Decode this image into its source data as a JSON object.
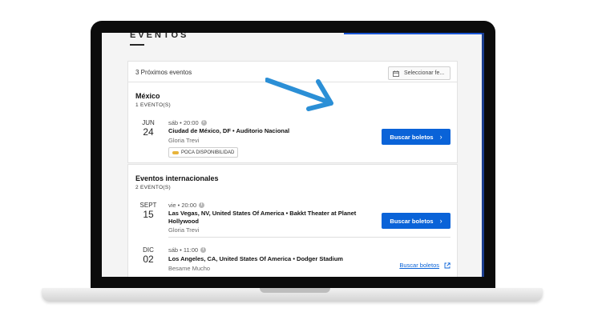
{
  "page": {
    "title": "EVENTOS"
  },
  "header": {
    "upcoming_count": "3 Próximos eventos",
    "date_picker_label": "Seleccionar fe..."
  },
  "sections": [
    {
      "title": "México",
      "count": "1 EVENTO(S)",
      "events": [
        {
          "month": "JUN",
          "day": "24",
          "time": "sáb • 20:00",
          "venue": "Ciudad de México, DF • Auditorio Nacional",
          "artist": "Gloria Trevi",
          "badge": "POCA DISPONIBILIDAD",
          "action": "Buscar boletos",
          "action_style": "button"
        }
      ]
    },
    {
      "title": "Eventos internacionales",
      "count": "2 EVENTO(S)",
      "events": [
        {
          "month": "SEPT",
          "day": "15",
          "time": "vie • 20:00",
          "venue": "Las Vegas, NV, United States Of America • Bakkt Theater at Planet Hollywood",
          "artist": "Gloria Trevi",
          "action": "Buscar boletos",
          "action_style": "button"
        },
        {
          "month": "DIC",
          "day": "02",
          "time": "sáb • 11:00",
          "venue": "Los Angeles, CA, United States Of America • Dodger Stadium",
          "artist": "Besame Mucho",
          "action": "Buscar boletos",
          "action_style": "link"
        }
      ]
    }
  ],
  "icons": {
    "calendar": "calendar-icon",
    "info": "info-icon",
    "chevron": "chevron-right-icon",
    "external": "external-link-icon",
    "arrow": "pointer-arrow"
  },
  "colors": {
    "primary": "#0a63d8",
    "badge_dot": "#e8b43a",
    "arrow": "#2b8fd6"
  }
}
